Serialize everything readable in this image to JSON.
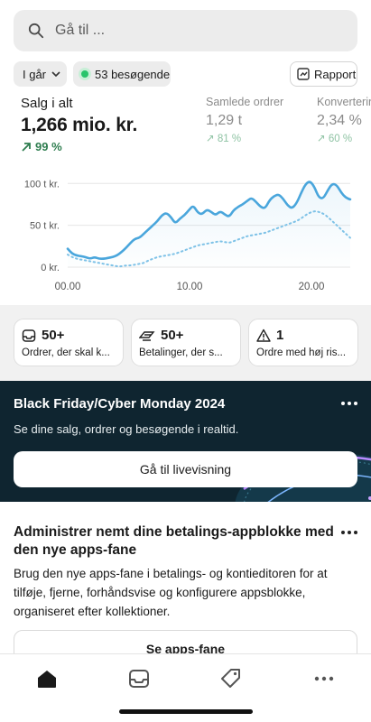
{
  "search": {
    "placeholder": "Gå til ..."
  },
  "filters": {
    "date": "I går",
    "visitors": "53 besøgende",
    "report": "Rapport"
  },
  "metrics": {
    "main": {
      "label": "Salg i alt",
      "value": "1,266 mio. kr.",
      "change": "99 %"
    },
    "orders": {
      "label": "Samlede ordrer",
      "value": "1,29 t",
      "change": "81 %"
    },
    "conversion": {
      "label": "Konvertering",
      "value": "2,34 %",
      "change": "60 %"
    }
  },
  "chart_data": {
    "type": "line",
    "y_ticks": [
      "100 t kr.",
      "50 t kr.",
      "0 kr."
    ],
    "x_ticks": [
      "00.00",
      "10.00",
      "20.00"
    ],
    "ylim": [
      0,
      110
    ],
    "series": [
      {
        "style": "solid",
        "values": [
          22,
          16,
          14,
          13,
          12,
          10,
          12,
          10,
          10,
          11,
          12,
          14,
          18,
          23,
          29,
          34,
          35,
          40,
          45,
          50,
          55,
          62,
          65,
          60,
          52,
          58,
          62,
          68,
          74,
          65,
          63,
          69,
          66,
          62,
          67,
          63,
          60,
          68,
          72,
          75,
          79,
          83,
          78,
          72,
          70,
          80,
          85,
          87,
          82,
          74,
          70,
          76,
          88,
          99,
          103,
          96,
          83,
          82,
          92,
          100,
          98,
          89,
          83,
          81
        ]
      },
      {
        "style": "dotted",
        "values": [
          15,
          12,
          10,
          9,
          8,
          7,
          6,
          5,
          4,
          3,
          2,
          1,
          1,
          2,
          2,
          3,
          4,
          5,
          8,
          10,
          12,
          13,
          14,
          15,
          16,
          18,
          20,
          22,
          24,
          26,
          27,
          28,
          29,
          30,
          31,
          30,
          29,
          31,
          33,
          35,
          37,
          38,
          39,
          40,
          41,
          43,
          45,
          47,
          49,
          51,
          53,
          55,
          58,
          62,
          65,
          67,
          66,
          64,
          60,
          55,
          50,
          45,
          40,
          35
        ]
      }
    ],
    "colors": {
      "solid": "#4aa6dc",
      "dotted": "#7ec2e7"
    }
  },
  "tiles": [
    {
      "icon": "inbox-icon",
      "count": "50+",
      "label": "Ordrer, der skal k..."
    },
    {
      "icon": "payment-icon",
      "count": "50+",
      "label": "Betalinger, der s..."
    },
    {
      "icon": "warning-icon",
      "count": "1",
      "label": "Ordre med høj ris..."
    }
  ],
  "banner": {
    "title": "Black Friday/Cyber Monday 2024",
    "desc": "Se dine salg, ordrer og besøgende i realtid.",
    "button": "Gå til livevisning"
  },
  "card": {
    "title": "Administrer nemt dine betalings-appblokke med den nye apps-fane",
    "body": "Brug den nye apps-fane i betalings- og kontieditoren for at tilføje, fjerne, forhåndsvise og konfigurere appsblokke, organiseret efter kollektioner.",
    "button": "Se apps-fane"
  },
  "nav": [
    "home-icon",
    "inbox-icon",
    "tag-icon",
    "more-icon"
  ]
}
